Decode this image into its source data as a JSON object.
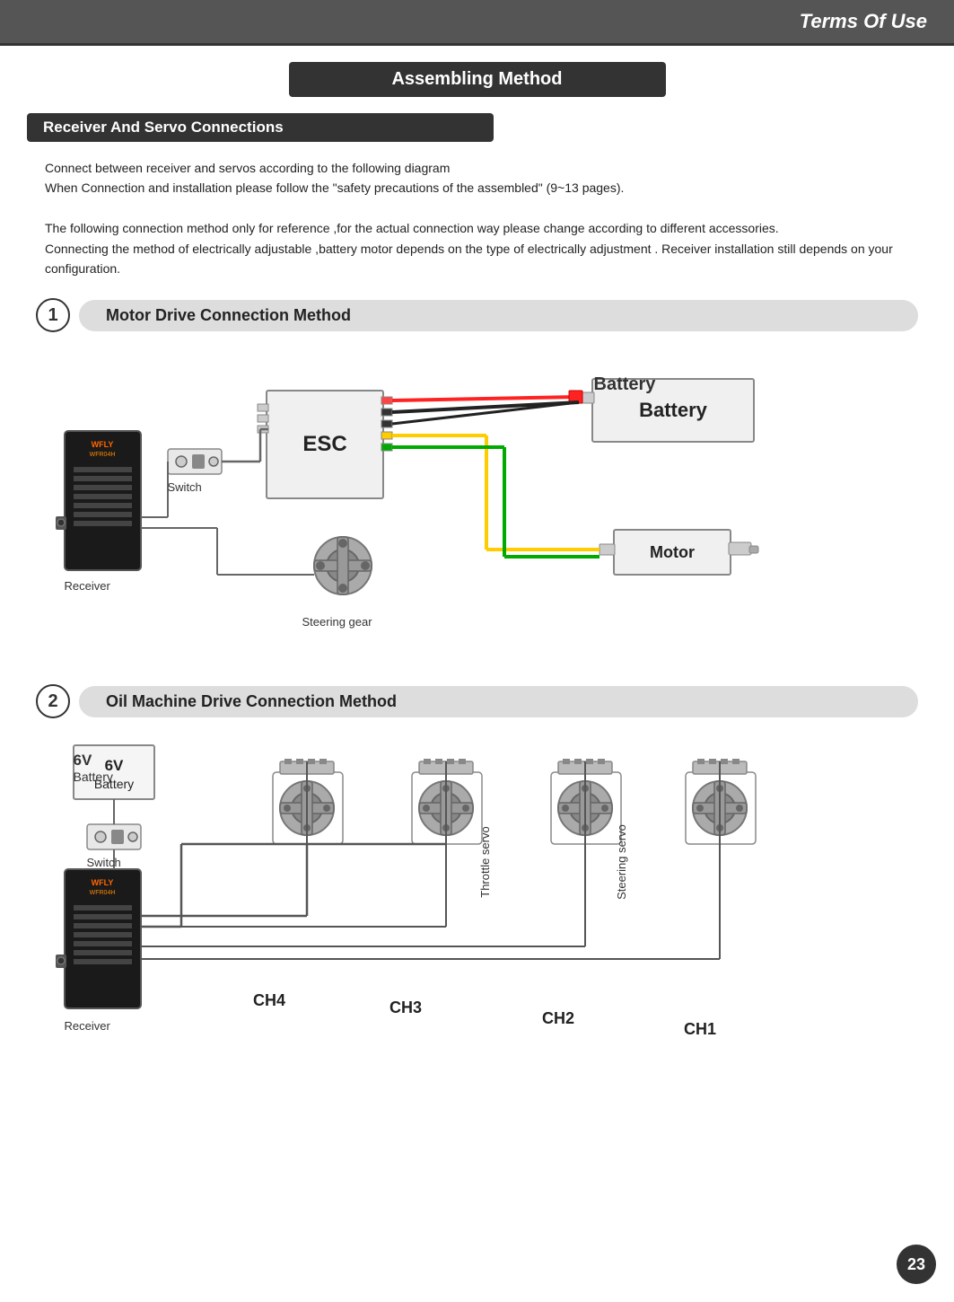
{
  "header": {
    "title": "Terms Of Use"
  },
  "section": {
    "main_title": "Assembling Method",
    "sub_title": "Receiver And Servo Connections",
    "description1": "Connect between receiver and servos according to the following diagram",
    "description2": "When Connection and installation please follow the \"safety precautions of the assembled\" (9~13 pages).",
    "description3": "The following connection method only for reference ,for the actual connection way please change according to different accessories.",
    "description4": "Connecting the method of electrically adjustable ,battery motor depends on the type of electrically adjustment . Receiver installation still depends on your configuration.",
    "method1": {
      "number": "1",
      "title": "Motor Drive Connection Method",
      "labels": {
        "esc": "ESC",
        "battery": "Battery",
        "motor": "Motor",
        "switch": "Switch",
        "receiver": "Receiver",
        "steering_gear": "Steering gear"
      }
    },
    "method2": {
      "number": "2",
      "title": "Oil Machine Drive Connection Method",
      "labels": {
        "battery6v": "6V",
        "battery_text": "Battery",
        "switch": "Switch",
        "receiver": "Receiver",
        "throttle_servo": "Throttle servo",
        "steering_servo": "Steering servo",
        "ch4": "CH4",
        "ch3": "CH3",
        "ch2": "CH2",
        "ch1": "CH1"
      }
    }
  },
  "page": {
    "number": "23"
  }
}
